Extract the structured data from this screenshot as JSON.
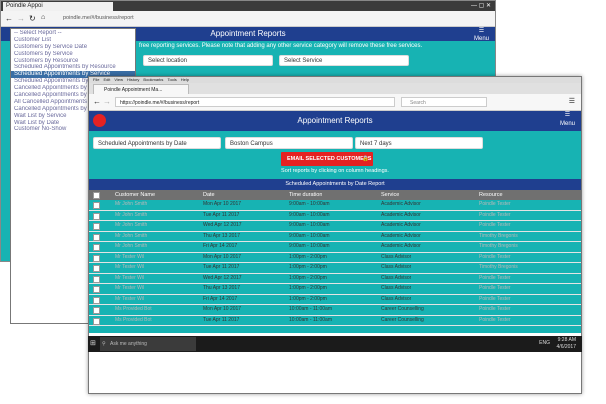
{
  "back_window": {
    "tab_title": "Poindle Appoi",
    "url": "poindle.me/#/business/report",
    "app_title": "Appointment Reports",
    "menu_label": "Menu",
    "note": "free reporting services. Please note that adding any other service category will remove these free services.",
    "location_placeholder": "Select location",
    "service_placeholder": "Select Service"
  },
  "dropdown": {
    "items": [
      "-- Select Report --",
      "Customer List",
      "Customers by Service Date",
      "Customers by Service",
      "Customers by Resource",
      "Scheduled Appointments by Resource",
      "Scheduled Appointments by Service",
      "Scheduled Appointments by Date",
      "Cancelled Appointments by Da",
      "Cancelled Appointments by Cu",
      "All Cancelled Appointments by S",
      "Cancelled Appointments by Se",
      "Wait List by Service",
      "Wait List by Date",
      "Customer No-Show"
    ],
    "active_index": 6
  },
  "front_window": {
    "menu_items": [
      "File",
      "Edit",
      "View",
      "History",
      "Bookmarks",
      "Tools",
      "Help"
    ],
    "tab_title": "Poindle Appointment Ma...",
    "url": "https://poindle.me/#/business/report",
    "search_placeholder": "Search",
    "app_title": "Appointment Reports",
    "menu_label": "Menu",
    "report_select": "Scheduled Appointments by Date",
    "location_select": "Boston Campus",
    "range_select": "Next 7 days",
    "email_button": "EMAIL SELECTED CUSTOMERS",
    "sort_hint": "Sort reports by clicking on column headings.",
    "table_title": "Scheduled Appointments by Date Report",
    "columns": [
      "Customer Name",
      "Date",
      "Time duration",
      "Service",
      "Resource"
    ],
    "rows": [
      [
        "Mr John Smith",
        "Mon Apr 10 2017",
        "9:00am - 10:00am",
        "Academic Advisor",
        "Poindle Tester"
      ],
      [
        "Mr John Smith",
        "Tue Apr 11 2017",
        "9:00am - 10:00am",
        "Academic Advisor",
        "Poindle Tester"
      ],
      [
        "Mr John Smith",
        "Wed Apr 12 2017",
        "9:00am - 10:00am",
        "Academic Advisor",
        "Poindle Tester"
      ],
      [
        "Mr John Smith",
        "Thu Apr 13 2017",
        "9:00am - 10:00am",
        "Academic Advisor",
        "Timothy Bregonis"
      ],
      [
        "Mr John Smith",
        "Fri Apr 14 2017",
        "9:00am - 10:00am",
        "Academic Advisor",
        "Timothy Bregonis"
      ],
      [
        "Mr Tester Wil",
        "Mon Apr 10 2017",
        "1:00pm - 2:00pm",
        "Class Advisor",
        "Poindle Tester"
      ],
      [
        "Mr Tester Wil",
        "Tue Apr 11 2017",
        "1:00pm - 2:00pm",
        "Class Advisor",
        "Timothy Bregonis"
      ],
      [
        "Mr Tester Wil",
        "Wed Apr 12 2017",
        "1:00pm - 2:00pm",
        "Class Advisor",
        "Poindle Tester"
      ],
      [
        "Mr Tester Wil",
        "Thu Apr 13 2017",
        "1:00pm - 2:00pm",
        "Class Advisor",
        "Poindle Tester"
      ],
      [
        "Mr Tester Wil",
        "Fri Apr 14 2017",
        "1:00pm - 2:00pm",
        "Class Advisor",
        "Poindle Tester"
      ],
      [
        "Ms Provided Bot",
        "Mon Apr 10 2017",
        "10:00am - 11:00am",
        "Career Counselling",
        "Poindle Tester"
      ],
      [
        "Ms Provided Bot",
        "Tue Apr 11 2017",
        "10:00am - 11:00am",
        "Career Counselling",
        "Poindle Tester"
      ]
    ]
  },
  "taskbar": {
    "search_placeholder": "Ask me anything",
    "time": "9:28 AM",
    "date": "4/6/2017",
    "lang": "ENG"
  },
  "colors": {
    "navy": "#1f3f8f",
    "teal": "#17b3b3",
    "red": "#e52222",
    "highlight": "#3a6ea5"
  },
  "icons": [
    "back-icon",
    "forward-icon",
    "refresh-icon",
    "home-icon",
    "hamburger-menu-icon",
    "checkbox-icon",
    "windows-start-icon",
    "lock-icon",
    "search-icon"
  ]
}
